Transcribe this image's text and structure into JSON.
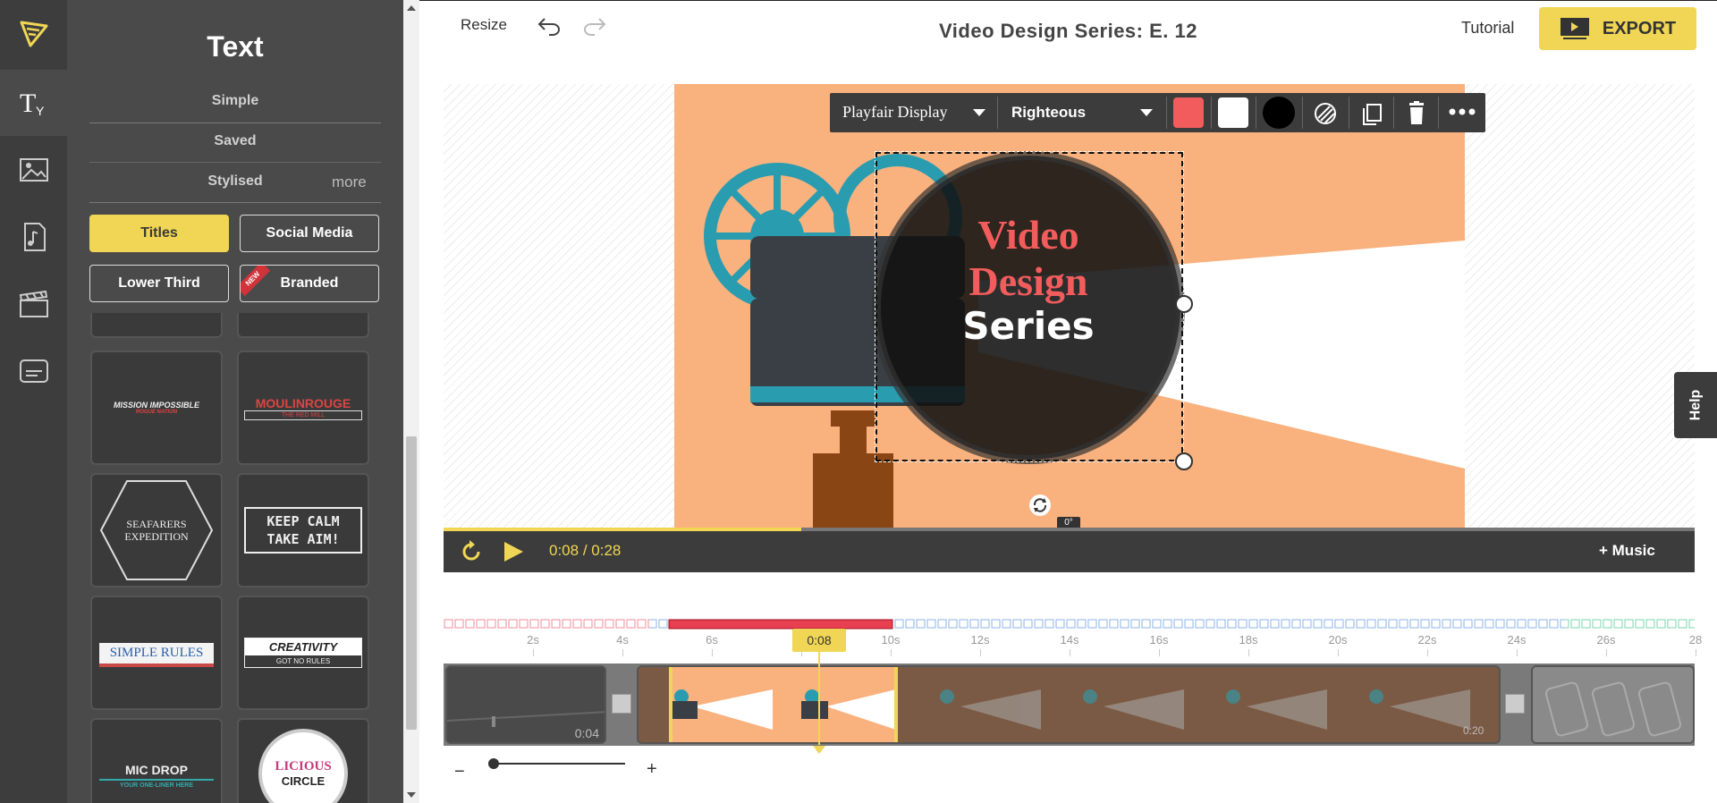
{
  "panel": {
    "title": "Text",
    "tabs": [
      "Simple",
      "Saved",
      "Stylised"
    ],
    "more_label": "more",
    "categories": [
      "Titles",
      "Social Media",
      "Lower Third",
      "Branded"
    ],
    "new_badge": "NEW",
    "templates": [
      {
        "line1": "MISSION IMPOSSIBLE",
        "line2": "ROGUE NATION"
      },
      {
        "line1": "MOULINROUGE",
        "line2": "THE RED MILL"
      },
      {
        "line1": "SEAFARERS",
        "line2": "EXPEDITION"
      },
      {
        "line1": "KEEP CALM",
        "line2": "TAKE AIM!"
      },
      {
        "line1": "SIMPLE RULES",
        "line2": ""
      },
      {
        "line1": "CREATIVITY",
        "line2": "GOT NO RULES"
      },
      {
        "line1": "MIC DROP",
        "line2": "YOUR ONE-LINER HERE"
      },
      {
        "line1": "LICIOUS",
        "line2": "CIRCLE"
      }
    ]
  },
  "topbar": {
    "resize_label": "Resize",
    "project_title": "Video Design Series: E. 12",
    "tutorial_label": "Tutorial",
    "export_label": "EXPORT"
  },
  "toolbar": {
    "font1": "Playfair Display",
    "font2": "Righteous",
    "colors": [
      "#f25c5c",
      "#ffffff",
      "#000000"
    ]
  },
  "stage": {
    "title_line1": "Video",
    "title_line2": "Design",
    "title_line3": "Series",
    "rotation_label": "0°"
  },
  "playback": {
    "current": "0:08",
    "separator": "/",
    "total": "0:28",
    "progress": 0.2857,
    "music_label": "+ Music"
  },
  "timeline": {
    "ticks": [
      "2s",
      "4s",
      "6s",
      "8s",
      "10s",
      "12s",
      "14s",
      "16s",
      "18s",
      "20s",
      "22s",
      "24s",
      "26s",
      "28"
    ],
    "playhead_label": "0:08",
    "clip1_duration": "0:04",
    "clip3_duration": "0:20"
  },
  "help_label": "Help"
}
